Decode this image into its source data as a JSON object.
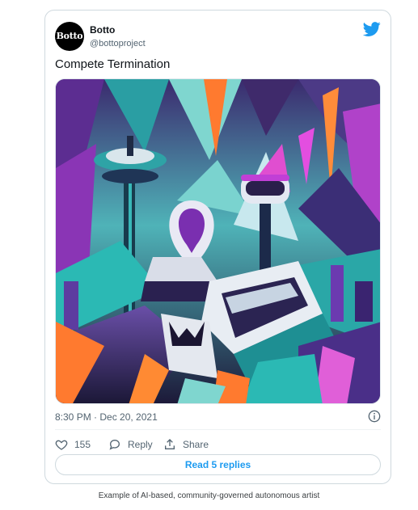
{
  "tweet": {
    "author_name": "Botto",
    "author_handle": "@bottoproject",
    "avatar_text": "Botto",
    "text": "Compete Termination",
    "timestamp": "8:30 PM · Dec 20, 2021",
    "likes": "155",
    "reply_label": "Reply",
    "share_label": "Share",
    "read_replies_label": "Read 5 replies",
    "icons": [
      "twitter-bird-icon",
      "info-icon",
      "heart-icon",
      "reply-bubble-icon",
      "share-icon"
    ],
    "accent_color": "#1d9bf0"
  },
  "caption": "Example of AI-based, community-governed autonomous artist"
}
